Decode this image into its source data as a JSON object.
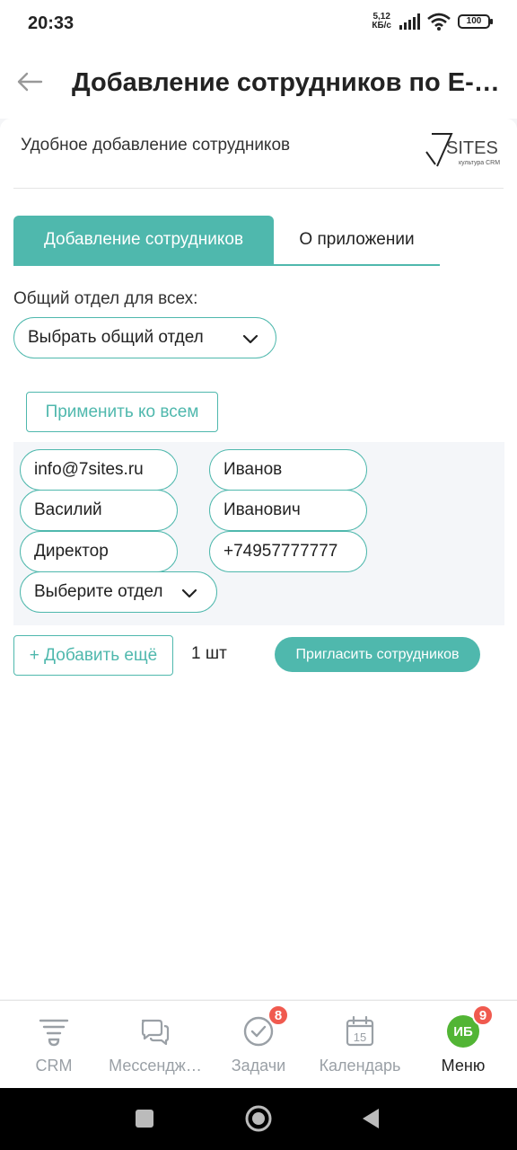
{
  "status_bar": {
    "time": "20:33",
    "net_speed_value": "5,12",
    "net_speed_unit": "КБ/с",
    "battery": "100"
  },
  "app_bar": {
    "title": "Добавление сотрудников по E-m…"
  },
  "app_header": {
    "name": "Удобное добавление сотрудников",
    "logo_text": "SITES",
    "logo_tagline": "культура CRM"
  },
  "tabs": [
    {
      "label": "Добавление сотрудников",
      "active": true
    },
    {
      "label": "О приложении",
      "active": false
    }
  ],
  "common_department": {
    "label": "Общий отдел для всех:",
    "select_value": "Выбрать общий отдел"
  },
  "apply_all_label": "Применить ко всем",
  "employee_row": {
    "email": "info@7sites.ru",
    "last_name": "Иванов",
    "first_name": "Василий",
    "middle_name": "Иванович",
    "position": "Директор",
    "phone": "+74957777777",
    "department_select": "Выберите отдел"
  },
  "add_more_label": "+ Добавить ещё",
  "count_label": "1 шт",
  "invite_label": "Пригласить сотрудников",
  "bottom_nav": [
    {
      "label": "CRM",
      "icon": "crm-icon"
    },
    {
      "label": "Мессендж…",
      "icon": "chat-bubbles-icon"
    },
    {
      "label": "Задачи",
      "icon": "check-circle-icon",
      "badge": "8"
    },
    {
      "label": "Календарь",
      "icon": "calendar-icon",
      "day": "15"
    },
    {
      "label": "Меню",
      "icon": "avatar-icon",
      "avatar_initials": "ИБ",
      "badge": "9"
    }
  ],
  "colors": {
    "accent": "#4fb8ad",
    "badge": "#f05a4f",
    "avatar": "#52b535"
  }
}
